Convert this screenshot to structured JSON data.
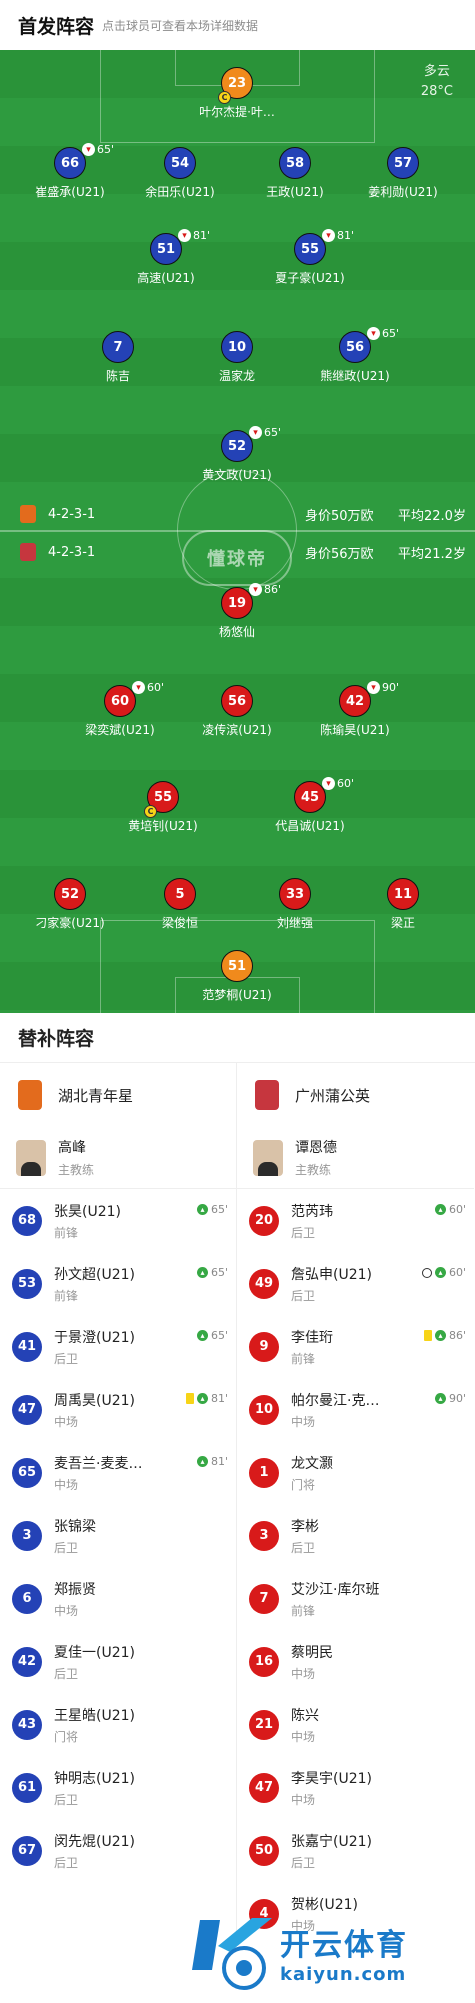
{
  "header": {
    "title": "首发阵容",
    "subtitle": "点击球员可查看本场详细数据"
  },
  "weather": {
    "condition": "多云",
    "temp": "28°C"
  },
  "watermark_brand": "懂球帝",
  "home_team": {
    "name": "湖北青年星",
    "formation": "4-2-3-1",
    "value": "身价50万欧",
    "avg_age": "平均22.0岁"
  },
  "away_team": {
    "name": "广州蒲公英",
    "formation": "4-2-3-1",
    "value": "身价56万欧",
    "avg_age": "平均21.2岁"
  },
  "lineup_home": [
    {
      "num": "23",
      "name": "叶尔杰提·叶…",
      "color": "orange",
      "cap": "C"
    },
    {
      "num": "66",
      "name": "崔盛承(U21)",
      "color": "blue",
      "ev": "65'"
    },
    {
      "num": "54",
      "name": "余田乐(U21)",
      "color": "blue"
    },
    {
      "num": "58",
      "name": "王政(U21)",
      "color": "blue"
    },
    {
      "num": "57",
      "name": "姜利勋(U21)",
      "color": "blue"
    },
    {
      "num": "51",
      "name": "高速(U21)",
      "color": "blue",
      "ev": "81'"
    },
    {
      "num": "55",
      "name": "夏子豪(U21)",
      "color": "blue",
      "ev": "81'"
    },
    {
      "num": "7",
      "name": "陈吉",
      "color": "blue"
    },
    {
      "num": "10",
      "name": "温家龙",
      "color": "blue"
    },
    {
      "num": "56",
      "name": "熊继政(U21)",
      "color": "blue",
      "ev": "65'"
    },
    {
      "num": "52",
      "name": "黄文政(U21)",
      "color": "blue",
      "ev": "65'"
    }
  ],
  "lineup_away": [
    {
      "num": "19",
      "name": "杨悠仙",
      "color": "red",
      "ev": "86'"
    },
    {
      "num": "60",
      "name": "梁奕斌(U21)",
      "color": "red",
      "ev": "60'"
    },
    {
      "num": "56",
      "name": "凌传滨(U21)",
      "color": "red"
    },
    {
      "num": "42",
      "name": "陈瑜昊(U21)",
      "color": "red",
      "ev": "90'"
    },
    {
      "num": "55",
      "name": "黄培钊(U21)",
      "color": "red",
      "cap": "C"
    },
    {
      "num": "45",
      "name": "代昌诚(U21)",
      "color": "red",
      "ev": "60'"
    },
    {
      "num": "52",
      "name": "刁家豪(U21)",
      "color": "red"
    },
    {
      "num": "5",
      "name": "梁俊恒",
      "color": "red"
    },
    {
      "num": "33",
      "name": "刘继强",
      "color": "red"
    },
    {
      "num": "11",
      "name": "梁正",
      "color": "red"
    },
    {
      "num": "51",
      "name": "范梦桐(U21)",
      "color": "orange"
    }
  ],
  "subs": {
    "title": "替补阵容",
    "home": {
      "team": "湖北青年星",
      "coach": {
        "name": "高峰",
        "role": "主教练"
      },
      "players": [
        {
          "num": "68",
          "name": "张昊(U21)",
          "pos": "前锋",
          "ev": "65'"
        },
        {
          "num": "53",
          "name": "孙文超(U21)",
          "pos": "前锋",
          "ev": "65'"
        },
        {
          "num": "41",
          "name": "于景澄(U21)",
          "pos": "后卫",
          "ev": "65'"
        },
        {
          "num": "47",
          "name": "周禹昊(U21)",
          "pos": "中场",
          "ev": "81'",
          "card": "yellow"
        },
        {
          "num": "65",
          "name": "麦吾兰·麦麦…",
          "pos": "中场",
          "ev": "81'"
        },
        {
          "num": "3",
          "name": "张锦梁",
          "pos": "后卫"
        },
        {
          "num": "6",
          "name": "郑振贤",
          "pos": "中场"
        },
        {
          "num": "42",
          "name": "夏佳一(U21)",
          "pos": "后卫"
        },
        {
          "num": "43",
          "name": "王星皓(U21)",
          "pos": "门将"
        },
        {
          "num": "61",
          "name": "钟明志(U21)",
          "pos": "后卫"
        },
        {
          "num": "67",
          "name": "闵先焜(U21)",
          "pos": "后卫"
        }
      ]
    },
    "away": {
      "team": "广州蒲公英",
      "coach": {
        "name": "谭恩德",
        "role": "主教练"
      },
      "players": [
        {
          "num": "20",
          "name": "范芮玮",
          "pos": "后卫",
          "ev": "60'"
        },
        {
          "num": "49",
          "name": "詹弘申(U21)",
          "pos": "后卫",
          "ev": "60'",
          "goal": true
        },
        {
          "num": "9",
          "name": "李佳珩",
          "pos": "前锋",
          "ev": "86'",
          "card": "yellow"
        },
        {
          "num": "10",
          "name": "帕尔曼江·克…",
          "pos": "中场",
          "ev": "90'"
        },
        {
          "num": "1",
          "name": "龙文灏",
          "pos": "门将"
        },
        {
          "num": "3",
          "name": "李彬",
          "pos": "后卫"
        },
        {
          "num": "7",
          "name": "艾沙江·库尔班",
          "pos": "前锋"
        },
        {
          "num": "16",
          "name": "蔡明民",
          "pos": "中场"
        },
        {
          "num": "21",
          "name": "陈兴",
          "pos": "中场"
        },
        {
          "num": "47",
          "name": "李昊宇(U21)",
          "pos": "中场"
        },
        {
          "num": "50",
          "name": "张嘉宁(U21)",
          "pos": "后卫"
        },
        {
          "num": "4",
          "name": "贺彬(U21)",
          "pos": "中场"
        }
      ]
    }
  },
  "kaiyun": {
    "cn": "开云体育",
    "en": "kaiyun.com"
  },
  "colors": {
    "pitch": "#2e9b3f",
    "home": "#2442b6",
    "away": "#d81a1a",
    "keeper": "#f08a1c"
  }
}
